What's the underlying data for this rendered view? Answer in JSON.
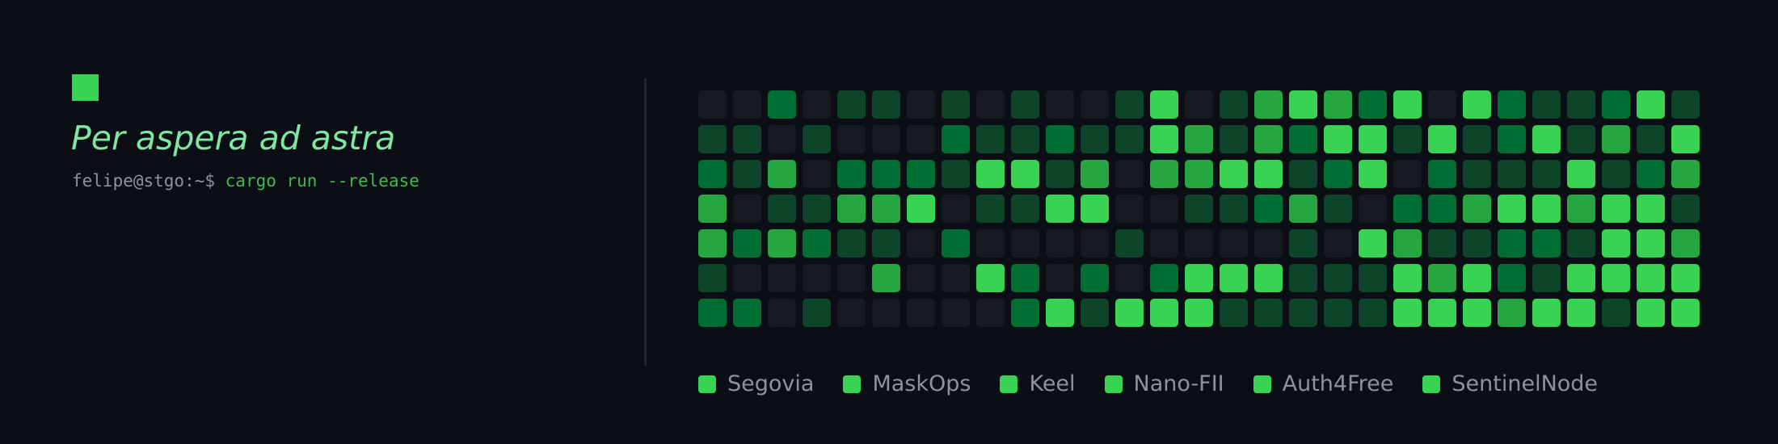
{
  "header": {
    "motto": "Per aspera ad astra",
    "prompt": "felipe@stgo:~$ ",
    "command": "cargo run --release",
    "accent_color": "#39d353",
    "motto_color": "#7ee8a2",
    "prompt_color": "#8b949e",
    "command_color": "#3fb950"
  },
  "contribution_grid": {
    "levels": [
      "#161b22",
      "#0e4429",
      "#006d32",
      "#26a641",
      "#39d353"
    ],
    "rows": [
      [
        0,
        0,
        2,
        0,
        1,
        1,
        0,
        1,
        0,
        1,
        0,
        0,
        1,
        4,
        0,
        1,
        3,
        4,
        3,
        2,
        4,
        0,
        4,
        2,
        1,
        1,
        2,
        4,
        1
      ],
      [
        1,
        1,
        0,
        1,
        0,
        0,
        0,
        2,
        1,
        1,
        2,
        1,
        1,
        4,
        3,
        1,
        3,
        2,
        4,
        4,
        1,
        4,
        1,
        2,
        4,
        1,
        3,
        1,
        4
      ],
      [
        2,
        1,
        3,
        0,
        2,
        2,
        2,
        1,
        4,
        4,
        1,
        3,
        0,
        3,
        3,
        4,
        4,
        1,
        2,
        4,
        0,
        2,
        1,
        1,
        1,
        4,
        1,
        2,
        3
      ],
      [
        3,
        0,
        1,
        1,
        3,
        3,
        4,
        0,
        1,
        1,
        4,
        4,
        0,
        0,
        1,
        1,
        2,
        3,
        1,
        0,
        2,
        2,
        3,
        4,
        4,
        3,
        4,
        4,
        1
      ],
      [
        3,
        2,
        3,
        2,
        1,
        1,
        0,
        2,
        0,
        0,
        0,
        0,
        1,
        0,
        0,
        0,
        0,
        1,
        0,
        4,
        3,
        1,
        1,
        2,
        2,
        1,
        4,
        4,
        3
      ],
      [
        1,
        0,
        0,
        0,
        0,
        3,
        0,
        0,
        4,
        2,
        0,
        2,
        0,
        2,
        4,
        4,
        4,
        1,
        1,
        1,
        4,
        3,
        4,
        2,
        1,
        4,
        4,
        4,
        4
      ],
      [
        2,
        2,
        0,
        1,
        0,
        0,
        0,
        0,
        0,
        2,
        4,
        1,
        4,
        4,
        4,
        1,
        1,
        1,
        1,
        1,
        4,
        4,
        4,
        3,
        4,
        4,
        1,
        4,
        4
      ]
    ]
  },
  "legend": {
    "swatch_color": "#39d353",
    "items": [
      {
        "label": "Segovia"
      },
      {
        "label": "MaskOps"
      },
      {
        "label": "Keel"
      },
      {
        "label": "Nano-FII"
      },
      {
        "label": "Auth4Free"
      },
      {
        "label": "SentinelNode"
      }
    ]
  }
}
